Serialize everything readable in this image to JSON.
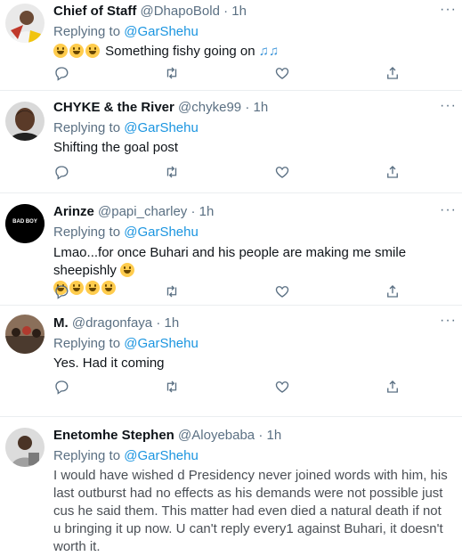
{
  "tweets": [
    {
      "name": "Chief of Staff",
      "handle": "@DhapoBold",
      "dot": "·",
      "time": "1h",
      "replying_prefix": "Replying to",
      "mention": "@GarShehu",
      "text": "Something fishy going on",
      "suffix_emoji": "♫♫"
    },
    {
      "name": "CHYKE & the River",
      "handle": "@chyke99",
      "dot": "·",
      "time": "1h",
      "replying_prefix": "Replying to",
      "mention": "@GarShehu",
      "text": "Shifting the goal post"
    },
    {
      "name": "Arinze",
      "handle": "@papi_charley",
      "dot": "·",
      "time": "1h",
      "avatar_text": "BAD BOY",
      "text": "Lmao...for once Buhari and his people are making me smile sheepishly"
    },
    {
      "name": "M.",
      "handle": "@dragonfaya",
      "dot": "·",
      "time": "1h",
      "replying_prefix": "Replying to",
      "mention": "@GarShehu",
      "text": "Yes. Had it coming"
    },
    {
      "name": "Enetomhe Stephen",
      "handle": "@Aloyebaba",
      "dot": "·",
      "time": "1h",
      "replying_prefix": "Replying to",
      "mention": "@GarShehu",
      "text": "I would have wished d Presidency never joined words with him, his last outburst had no effects as his demands were not possible just cus he said them. This matter had even died a natural death if not u bringing it up now. U can't reply every1 against Buhari, it doesn't worth it."
    }
  ],
  "more_glyph": "···",
  "colors": {
    "name": "#0f1419",
    "secondary": "#5b7083",
    "mention": "#1b95e0",
    "divider": "#ebeef0"
  },
  "icons": [
    "reply-icon",
    "retweet-icon",
    "like-icon",
    "share-icon",
    "more-icon"
  ]
}
